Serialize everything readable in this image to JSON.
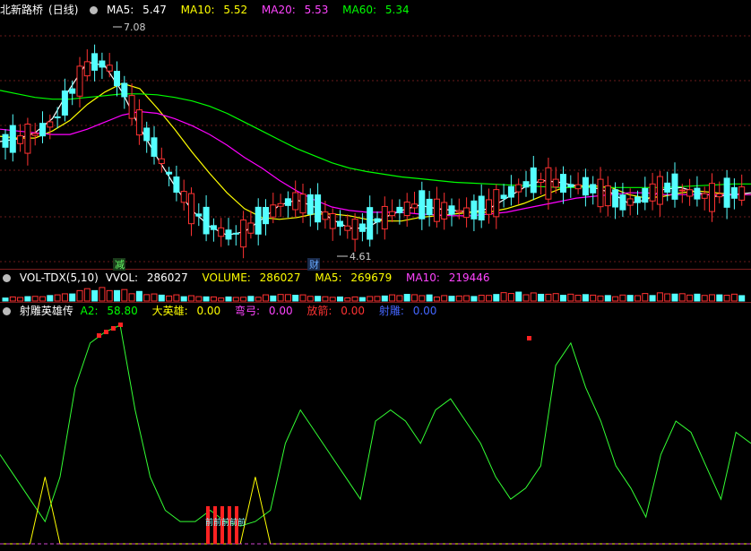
{
  "price_panel": {
    "stock_name": "北新路桥",
    "period": "(日线)",
    "ma5_label": "MA5:",
    "ma5_value": "5.47",
    "ma10_label": "MA10:",
    "ma10_value": "5.52",
    "ma20_label": "MA20:",
    "ma20_value": "5.53",
    "ma60_label": "MA60:",
    "ma60_value": "5.34",
    "high_marker": "7.08",
    "low_marker": "4.61",
    "flag_jian": "减",
    "flag_cai": "财",
    "colors": {
      "ma5": "#ffffff",
      "ma10": "#ffff00",
      "ma20": "#ff00ff",
      "ma60": "#00ff00",
      "up": "#ff3232",
      "down": "#54ffff"
    }
  },
  "vol_panel": {
    "name": "VOL-TDX(5,10)",
    "vvol_label": "VVOL:",
    "vvol_value": "286027",
    "volume_label": "VOLUME:",
    "volume_value": "286027",
    "ma5_label": "MA5:",
    "ma5_value": "269679",
    "ma10_label": "MA10:",
    "ma10_value": "219446"
  },
  "ind_panel": {
    "name": "射雕英雄传",
    "a2_label": "A2:",
    "a2_value": "58.80",
    "dayx_label": "大英雄:",
    "dayx_value": "0.00",
    "gong_label": "弯弓:",
    "gong_value": "0.00",
    "jian_label": "放箭:",
    "jian_value": "0.00",
    "shediao_label": "射雕:",
    "shediao_value": "0.00",
    "bar_text": "前前前前前"
  },
  "chart_data": [
    {
      "type": "candlestick",
      "title": "北新路桥(日线)",
      "ylim": [
        4.4,
        7.2
      ],
      "annotations": [
        {
          "text": "7.08",
          "value": 7.08
        },
        {
          "text": "4.61",
          "value": 4.61
        }
      ],
      "series": [
        {
          "name": "MA5",
          "values": [
            5.82,
            5.85,
            5.92,
            6.08,
            6.42,
            6.72,
            6.68,
            6.38,
            5.98,
            5.64,
            5.32,
            5.04,
            4.86,
            4.76,
            4.8,
            4.94,
            5.1,
            5.16,
            5.08,
            4.94,
            4.84,
            4.84,
            4.96,
            5.04,
            5.1,
            5.06,
            5.04,
            5.02,
            5.06,
            5.18,
            5.3,
            5.38,
            5.36,
            5.32,
            5.3,
            5.24,
            5.12,
            5.16,
            5.28,
            5.3,
            5.24,
            5.2,
            5.22,
            5.24
          ]
        },
        {
          "name": "MA10",
          "values": [
            5.88,
            5.86,
            5.86,
            5.94,
            6.06,
            6.24,
            6.38,
            6.48,
            6.42,
            6.2,
            5.96,
            5.7,
            5.46,
            5.24,
            5.06,
            4.96,
            4.94,
            4.96,
            5.0,
            5.0,
            4.98,
            4.94,
            4.92,
            4.92,
            4.96,
            4.98,
            5.0,
            5.02,
            5.02,
            5.06,
            5.12,
            5.2,
            5.28,
            5.32,
            5.32,
            5.3,
            5.22,
            5.18,
            5.2,
            5.24,
            5.26,
            5.24,
            5.22,
            5.22
          ]
        },
        {
          "name": "MA20",
          "values": [
            5.96,
            5.94,
            5.92,
            5.9,
            5.9,
            5.96,
            6.04,
            6.12,
            6.16,
            6.14,
            6.08,
            6.0,
            5.9,
            5.78,
            5.64,
            5.52,
            5.38,
            5.26,
            5.16,
            5.08,
            5.04,
            5.02,
            5.02,
            5.02,
            5.0,
            4.99,
            4.98,
            4.98,
            5.0,
            5.02,
            5.06,
            5.1,
            5.14,
            5.18,
            5.2,
            5.22,
            5.24,
            5.24,
            5.22,
            5.22,
            5.22,
            5.22,
            5.22,
            5.22
          ]
        },
        {
          "name": "MA60",
          "values": [
            6.4,
            6.36,
            6.32,
            6.3,
            6.3,
            6.32,
            6.34,
            6.36,
            6.36,
            6.35,
            6.32,
            6.28,
            6.22,
            6.14,
            6.04,
            5.94,
            5.84,
            5.74,
            5.66,
            5.58,
            5.52,
            5.48,
            5.45,
            5.42,
            5.4,
            5.38,
            5.36,
            5.35,
            5.34,
            5.33,
            5.32,
            5.31,
            5.3,
            5.3,
            5.3,
            5.3,
            5.3,
            5.3,
            5.3,
            5.31,
            5.32,
            5.33,
            5.34,
            5.34
          ]
        }
      ]
    },
    {
      "type": "bar",
      "title": "VOL-TDX(5,10)",
      "series": [
        {
          "name": "VOLUME",
          "values": [
            0.3,
            0.35,
            0.4,
            0.55,
            0.9,
            1.0,
            0.85,
            0.7,
            0.55,
            0.45,
            0.4,
            0.35,
            0.3,
            0.3,
            0.35,
            0.45,
            0.5,
            0.45,
            0.35,
            0.3,
            0.3,
            0.35,
            0.45,
            0.5,
            0.45,
            0.4,
            0.4,
            0.42,
            0.5,
            0.65,
            0.6,
            0.55,
            0.55,
            0.5,
            0.45,
            0.4,
            0.45,
            0.55,
            0.6,
            0.55,
            0.5,
            0.48,
            0.5,
            0.52
          ]
        }
      ]
    },
    {
      "type": "line",
      "title": "射雕英雄传",
      "series": [
        {
          "name": "A2",
          "values": [
            40,
            30,
            20,
            10,
            30,
            70,
            90,
            95,
            98,
            60,
            30,
            15,
            10,
            10,
            15,
            10,
            8,
            10,
            15,
            45,
            60,
            50,
            40,
            30,
            20,
            55,
            60,
            55,
            45,
            60,
            65,
            55,
            45,
            30,
            20,
            25,
            35,
            80,
            90,
            70,
            55,
            35,
            25,
            12,
            40,
            55,
            50,
            35,
            20,
            50,
            45
          ]
        },
        {
          "name": "大英雄",
          "values": [
            0,
            0,
            0,
            30,
            0,
            0,
            0,
            0,
            0,
            0,
            0,
            0,
            0,
            0,
            0,
            0,
            0,
            30,
            0,
            0,
            0,
            0,
            0,
            0,
            0,
            0,
            0,
            0,
            0,
            0,
            0,
            0,
            0,
            0,
            0,
            0,
            0,
            0,
            0,
            0,
            0,
            0,
            0,
            0,
            0,
            0,
            0,
            0,
            0,
            0,
            0
          ]
        }
      ]
    }
  ]
}
